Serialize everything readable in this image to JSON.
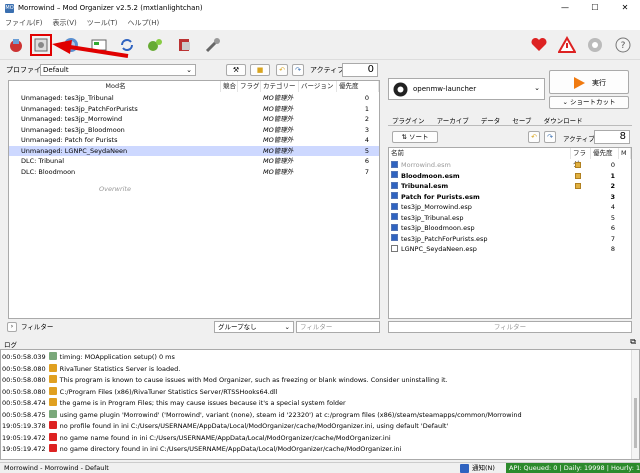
{
  "window": {
    "title": "Morrowind – Mod Organizer v2.5.2 (mxtlanlightchan)",
    "app_icon": "mo2-icon"
  },
  "menu": [
    "ファイル(F)",
    "表示(V)",
    "ツール(T)",
    "ヘルプ(H)"
  ],
  "profile": {
    "label": "プロファイル",
    "value": "Default",
    "active_label": "アクティブ:",
    "active_count": "0"
  },
  "left_table": {
    "headers": [
      "Mod名",
      "競合",
      "フラグ",
      "カテゴリー",
      "バージョン",
      "優先度"
    ],
    "rows": [
      {
        "name": "Unmanaged: tes3jp_Tribunal",
        "category": "MO管理外",
        "priority": "0",
        "selected": false
      },
      {
        "name": "Unmanaged: tes3jp_PatchForPurists",
        "category": "MO管理外",
        "priority": "1",
        "selected": false
      },
      {
        "name": "Unmanaged: tes3jp_Morrowind",
        "category": "MO管理外",
        "priority": "2",
        "selected": false
      },
      {
        "name": "Unmanaged: tes3jp_Bloodmoon",
        "category": "MO管理外",
        "priority": "3",
        "selected": false
      },
      {
        "name": "Unmanaged: Patch for Purists",
        "category": "MO管理外",
        "priority": "4",
        "selected": false
      },
      {
        "name": "Unmanaged: LGNPC_SeydaNeen",
        "category": "MO管理外",
        "priority": "5",
        "selected": true
      },
      {
        "name": "DLC: Tribunal",
        "category": "MO管理外",
        "priority": "6",
        "selected": false
      },
      {
        "name": "DLC: Bloodmoon",
        "category": "MO管理外",
        "priority": "7",
        "selected": false
      }
    ],
    "overwrite": "Overwrite"
  },
  "left_bottom": {
    "filter_label": "フィルター",
    "group_value": "グループなし",
    "filter_placeholder": "フィルター"
  },
  "executable": {
    "name": "openmw-launcher",
    "run_label": "実行",
    "shortcut_label": "ショートカット"
  },
  "right_tabs": [
    "プラグイン",
    "アーカイブ",
    "データ",
    "セーブ",
    "ダウンロード"
  ],
  "right_toolbar": {
    "sort_label": "ソート",
    "active_label": "アクティブ:",
    "active_count": "8"
  },
  "right_table": {
    "headers": [
      "名前",
      "フラグ",
      "優先度",
      "M"
    ],
    "rows": [
      {
        "name": "Morrowind.esm",
        "priority": "0",
        "checked": true,
        "bold": false,
        "grey": true,
        "flag": true
      },
      {
        "name": "Bloodmoon.esm",
        "priority": "1",
        "checked": true,
        "bold": true,
        "grey": false,
        "flag": true
      },
      {
        "name": "Tribunal.esm",
        "priority": "2",
        "checked": true,
        "bold": true,
        "grey": false,
        "flag": true
      },
      {
        "name": "Patch for Purists.esm",
        "priority": "3",
        "checked": true,
        "bold": true,
        "grey": false,
        "flag": false
      },
      {
        "name": "tes3jp_Morrowind.esp",
        "priority": "4",
        "checked": true,
        "bold": false,
        "grey": false,
        "flag": false
      },
      {
        "name": "tes3jp_Tribunal.esp",
        "priority": "5",
        "checked": true,
        "bold": false,
        "grey": false,
        "flag": false
      },
      {
        "name": "tes3jp_Bloodmoon.esp",
        "priority": "6",
        "checked": true,
        "bold": false,
        "grey": false,
        "flag": false
      },
      {
        "name": "tes3jp_PatchForPurists.esp",
        "priority": "7",
        "checked": true,
        "bold": false,
        "grey": false,
        "flag": false
      },
      {
        "name": "LGNPC_SeydaNeen.esp",
        "priority": "8",
        "checked": false,
        "bold": false,
        "grey": false,
        "flag": false
      }
    ],
    "filter_placeholder": "フィルター"
  },
  "log": {
    "title": "ログ",
    "entries": [
      {
        "time": "00:50:58.039",
        "level": "debug",
        "text": "timing: MOApplication setup() 0 ms"
      },
      {
        "time": "00:50:58.080",
        "level": "warning",
        "text": "RivaTuner Statistics Server is loaded."
      },
      {
        "time": "00:50:58.080",
        "level": "warning",
        "text": "This program is known to cause issues with Mod Organizer, such as freezing or blank windows. Consider uninstalling it."
      },
      {
        "time": "00:50:58.080",
        "level": "warning",
        "text": "C:/Program Files (x86)/RivaTuner Statistics Server/RTSSHooks64.dll"
      },
      {
        "time": "00:50:58.474",
        "level": "warning",
        "text": "the game is in Program Files; this may cause issues because it's a special system folder"
      },
      {
        "time": "00:50:58.475",
        "level": "debug",
        "text": "using game plugin 'Morrowind' ('Morrowind', variant (none), steam id '22320') at c:/program files (x86)/steam/steamapps/common/Morrowind"
      },
      {
        "time": "19:05:19.378",
        "level": "error",
        "text": "no profile found in ini C:/Users/USERNAME/AppData/Local/ModOrganizer/cache/ModOrganizer.ini, using default 'Default'"
      },
      {
        "time": "19:05:19.472",
        "level": "error",
        "text": "no game name found in ini C:/Users/USERNAME/AppData/Local/ModOrganizer/cache/ModOrganizer.ini"
      },
      {
        "time": "19:05:19.472",
        "level": "error",
        "text": "no game directory found in ini C:/Users/USERNAME/AppData/Local/ModOrganizer/cache/ModOrganizer.ini"
      }
    ]
  },
  "status": {
    "path": "Morrowind - Morrowind - Default",
    "notify": "通知(N)",
    "api": "API: Queued: 0 | Daily: 19998 | Hourly: 1998"
  },
  "colors": {
    "accent": "#2f63c0",
    "selected_row": "#cdd8ff",
    "arrow": "#e00000",
    "api_bg": "#2c8a2c",
    "run_icon": "#f07a10"
  }
}
